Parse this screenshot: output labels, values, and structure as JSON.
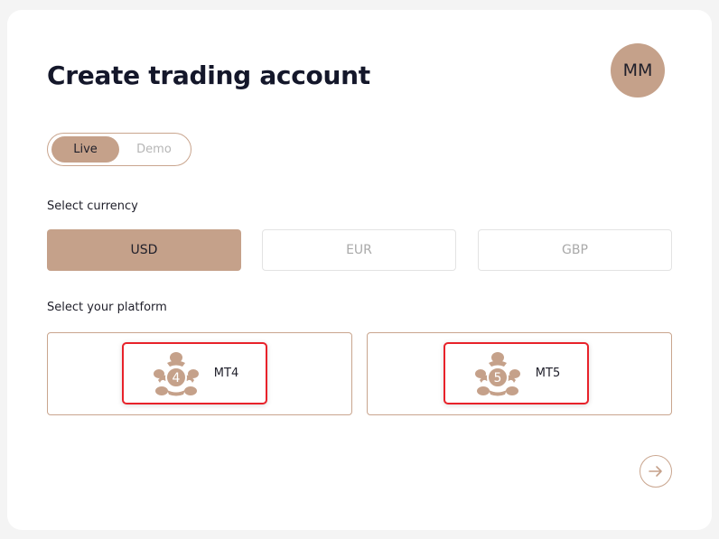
{
  "header": {
    "title": "Create trading account",
    "avatar_initials": "MM"
  },
  "account_type": {
    "options": [
      {
        "label": "Live",
        "selected": true
      },
      {
        "label": "Demo",
        "selected": false
      }
    ]
  },
  "currency": {
    "label": "Select currency",
    "options": [
      {
        "label": "USD",
        "selected": true
      },
      {
        "label": "EUR",
        "selected": false
      },
      {
        "label": "GBP",
        "selected": false
      }
    ]
  },
  "platform": {
    "label": "Select your platform",
    "options": [
      {
        "label": "MT4",
        "icon": "metatrader-4-icon",
        "badge": "4"
      },
      {
        "label": "MT5",
        "icon": "metatrader-5-icon",
        "badge": "5"
      }
    ]
  },
  "icons": {
    "next": "arrow-right-icon"
  },
  "colors": {
    "accent": "#c5a18a",
    "border_accent": "#c9a58e",
    "highlight_border": "#e8222a",
    "title": "#14172a"
  }
}
